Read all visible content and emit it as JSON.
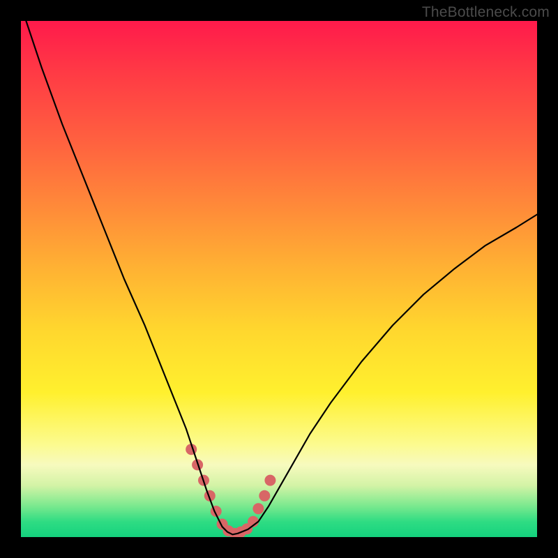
{
  "watermark": "TheBottleneck.com",
  "colors": {
    "page_bg": "#000000",
    "curve": "#000000",
    "marker": "#d86666",
    "gradient_top": "#ff1a4b",
    "gradient_bottom": "#14d27e"
  },
  "chart_data": {
    "type": "line",
    "title": "",
    "xlabel": "",
    "ylabel": "",
    "xlim": [
      0,
      100
    ],
    "ylim": [
      0,
      100
    ],
    "grid": false,
    "series": [
      {
        "name": "curve",
        "x": [
          1,
          4,
          8,
          12,
          16,
          20,
          24,
          28,
          30,
          32,
          34,
          36,
          37.5,
          39,
          40,
          41,
          42,
          44,
          46,
          48,
          52,
          56,
          60,
          66,
          72,
          78,
          84,
          90,
          96,
          100
        ],
        "y": [
          100,
          91,
          80,
          70,
          60,
          50,
          41,
          31,
          26,
          21,
          15,
          9,
          5,
          2,
          1,
          0.5,
          0.7,
          1.5,
          3,
          6,
          13,
          20,
          26,
          34,
          41,
          47,
          52,
          56.5,
          60,
          62.5
        ]
      }
    ],
    "markers": {
      "name": "highlight-dots",
      "x": [
        33,
        34.2,
        35.4,
        36.6,
        37.8,
        39,
        40.2,
        41.4,
        42.6,
        43.8,
        45,
        46,
        47.2,
        48.3
      ],
      "y": [
        17,
        14,
        11,
        8,
        5,
        2.5,
        1.2,
        0.7,
        1,
        1.6,
        3,
        5.5,
        8,
        11
      ]
    }
  }
}
